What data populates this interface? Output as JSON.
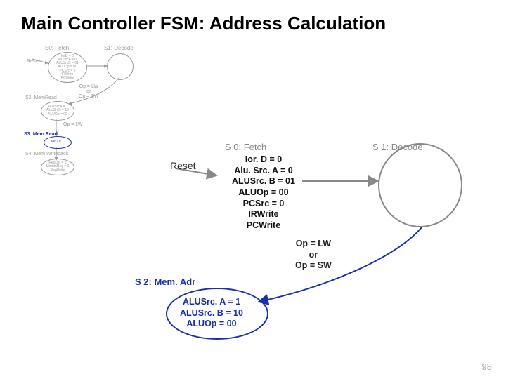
{
  "title": "Main Controller FSM: Address Calculation",
  "page_number": "98",
  "thumb": {
    "reset_label": "Reset",
    "s0_label": "S0: Fetch",
    "s1_label": "S1: Decode",
    "s2_label": "S2: MemRead",
    "s3_label": "S3: Mem Read",
    "s4_label": "S4: Mem Writeback",
    "s0_ops": "IorD = 0\nAluSrcA = 0\nALUSrcB = 01\nALUOp = 00\nPCSrc = 0\nIRWrite\nPCWrite",
    "s2_ops": "ALUSrcA = 1\nALUSrcB = 10\nALUOp = 00",
    "s3_ops": "IorD = 1",
    "s4_ops": "RegDst = 0\nMemtoReg = 1\nRegWrite",
    "branch1": "Op = LW\nor\nOp = SW",
    "branch2": "Op = LW"
  },
  "big": {
    "reset_label": "Reset",
    "s0_label": "S 0: Fetch",
    "s1_label": "S 1: Decode",
    "s2_label": "S 2: Mem. Adr",
    "s0_ops": "Ior. D = 0\nAlu. Src. A = 0\nALUSrc. B = 01\nALUOp = 00\nPCSrc = 0\nIRWrite\nPCWrite",
    "s2_ops": "ALUSrc. A = 1\nALUSrc. B = 10\nALUOp = 00",
    "branch": "Op = LW\nor\nOp = SW"
  }
}
